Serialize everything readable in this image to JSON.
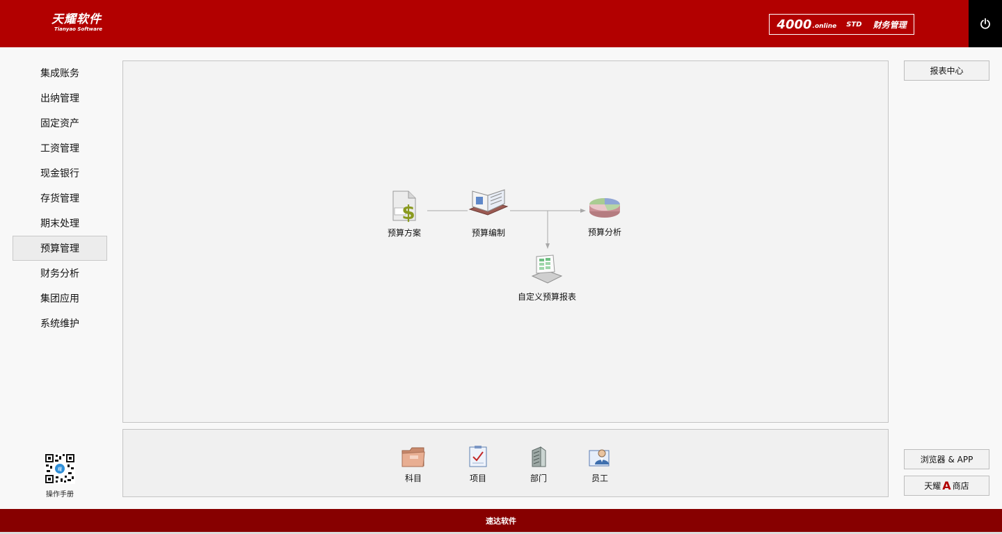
{
  "header": {
    "logo_main": "天耀软件",
    "logo_sub": "Tianyao Software",
    "product": {
      "number": "4000",
      "online": ".online",
      "edition": "STD",
      "name": "财务管理"
    }
  },
  "sidebar": {
    "items": [
      {
        "label": "集成账务"
      },
      {
        "label": "出纳管理"
      },
      {
        "label": "固定资产"
      },
      {
        "label": "工资管理"
      },
      {
        "label": "现金银行"
      },
      {
        "label": "存货管理"
      },
      {
        "label": "期末处理"
      },
      {
        "label": "预算管理",
        "active": true
      },
      {
        "label": "财务分析"
      },
      {
        "label": "集团应用"
      },
      {
        "label": "系统维护"
      }
    ],
    "manual_label": "操作手册"
  },
  "flow": {
    "budget_plan": "预算方案",
    "budget_compile": "预算编制",
    "budget_analysis": "预算分析",
    "custom_report": "自定义预算报表"
  },
  "base_data": {
    "subject": "科目",
    "project": "项目",
    "department": "部门",
    "employee": "员工"
  },
  "right_buttons": {
    "report_center": "报表中心",
    "browser_app": "浏览器 & APP",
    "store_prefix": "天耀",
    "store_a": "A",
    "store_suffix": "商店"
  },
  "footer": {
    "text": "速达软件"
  },
  "colors": {
    "header_red": "#b20000",
    "footer_red": "#870000",
    "power_bg": "#000000"
  },
  "icons": {
    "power": "power-icon",
    "qr": "qr-code-icon",
    "budget_plan": "budget-plan-icon",
    "budget_compile": "budget-compile-icon",
    "budget_analysis": "pie-chart-icon",
    "custom_report": "report-sheet-icon",
    "subject": "folder-icon",
    "project": "checklist-icon",
    "department": "building-icon",
    "employee": "employee-icon"
  }
}
